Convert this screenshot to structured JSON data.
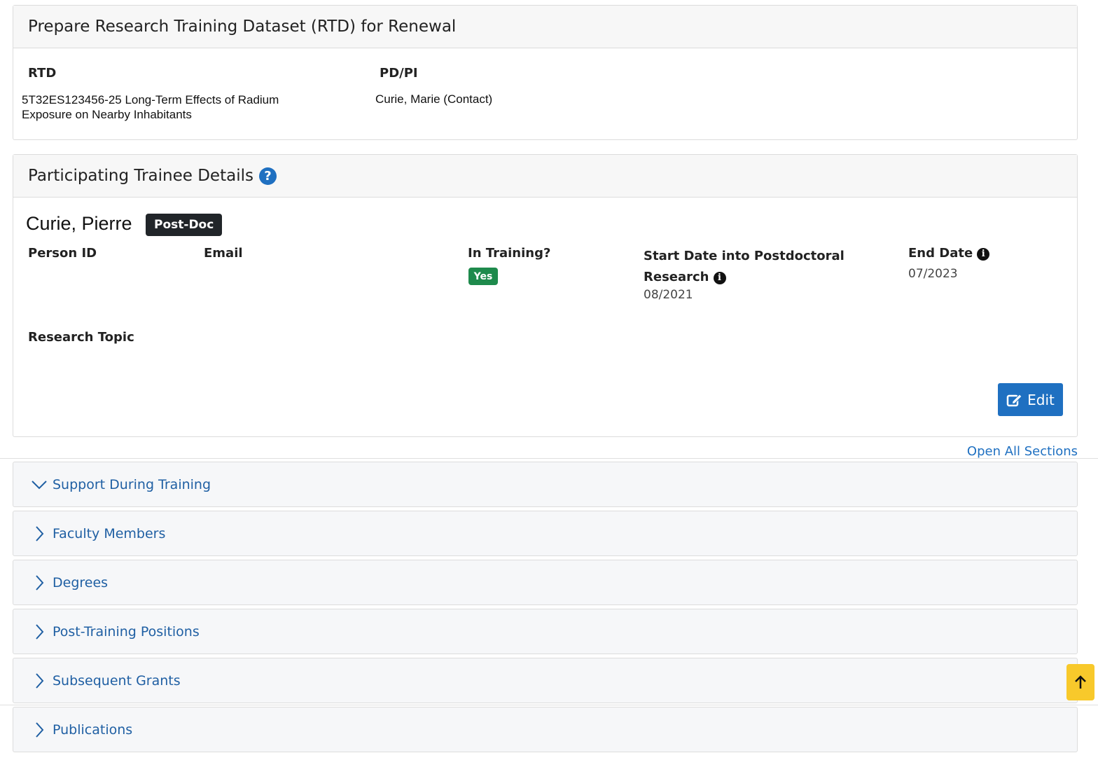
{
  "rtd_card": {
    "title": "Prepare Research Training Dataset (RTD) for Renewal",
    "rtd_label": "RTD",
    "rtd_value_line1": "5T32ES123456-25 Long-Term Effects of Radium",
    "rtd_value_line2": "Exposure on Nearby Inhabitants",
    "pdpi_label": "PD/PI",
    "pdpi_value": "Curie, Marie (Contact)"
  },
  "trainee_card": {
    "title": "Participating Trainee Details",
    "help_icon": "question-circle-icon",
    "trainee_name": "Curie, Pierre",
    "trainee_badge": "Post-Doc",
    "person_id_label": "Person ID",
    "email_label": "Email",
    "in_training_label": "In Training?",
    "in_training_value": "Yes",
    "start_date_label_line1": "Start Date into Postdoctoral",
    "start_date_label_line2": "Research",
    "start_date_value": "08/2021",
    "end_date_label": "End Date",
    "end_date_value": "07/2023",
    "research_topic_label": "Research Topic",
    "edit_button": "Edit"
  },
  "open_all_sections": "Open All Sections",
  "sections": [
    {
      "label": "Support During Training",
      "expanded": true
    },
    {
      "label": "Faculty Members",
      "expanded": false
    },
    {
      "label": "Degrees",
      "expanded": false
    },
    {
      "label": "Post-Training Positions",
      "expanded": false
    },
    {
      "label": "Subsequent Grants",
      "expanded": false
    },
    {
      "label": "Publications",
      "expanded": false
    }
  ],
  "colors": {
    "primary": "#1f70c1",
    "success": "#1e8a4c",
    "dark": "#212529",
    "warning": "#f8c92b"
  }
}
